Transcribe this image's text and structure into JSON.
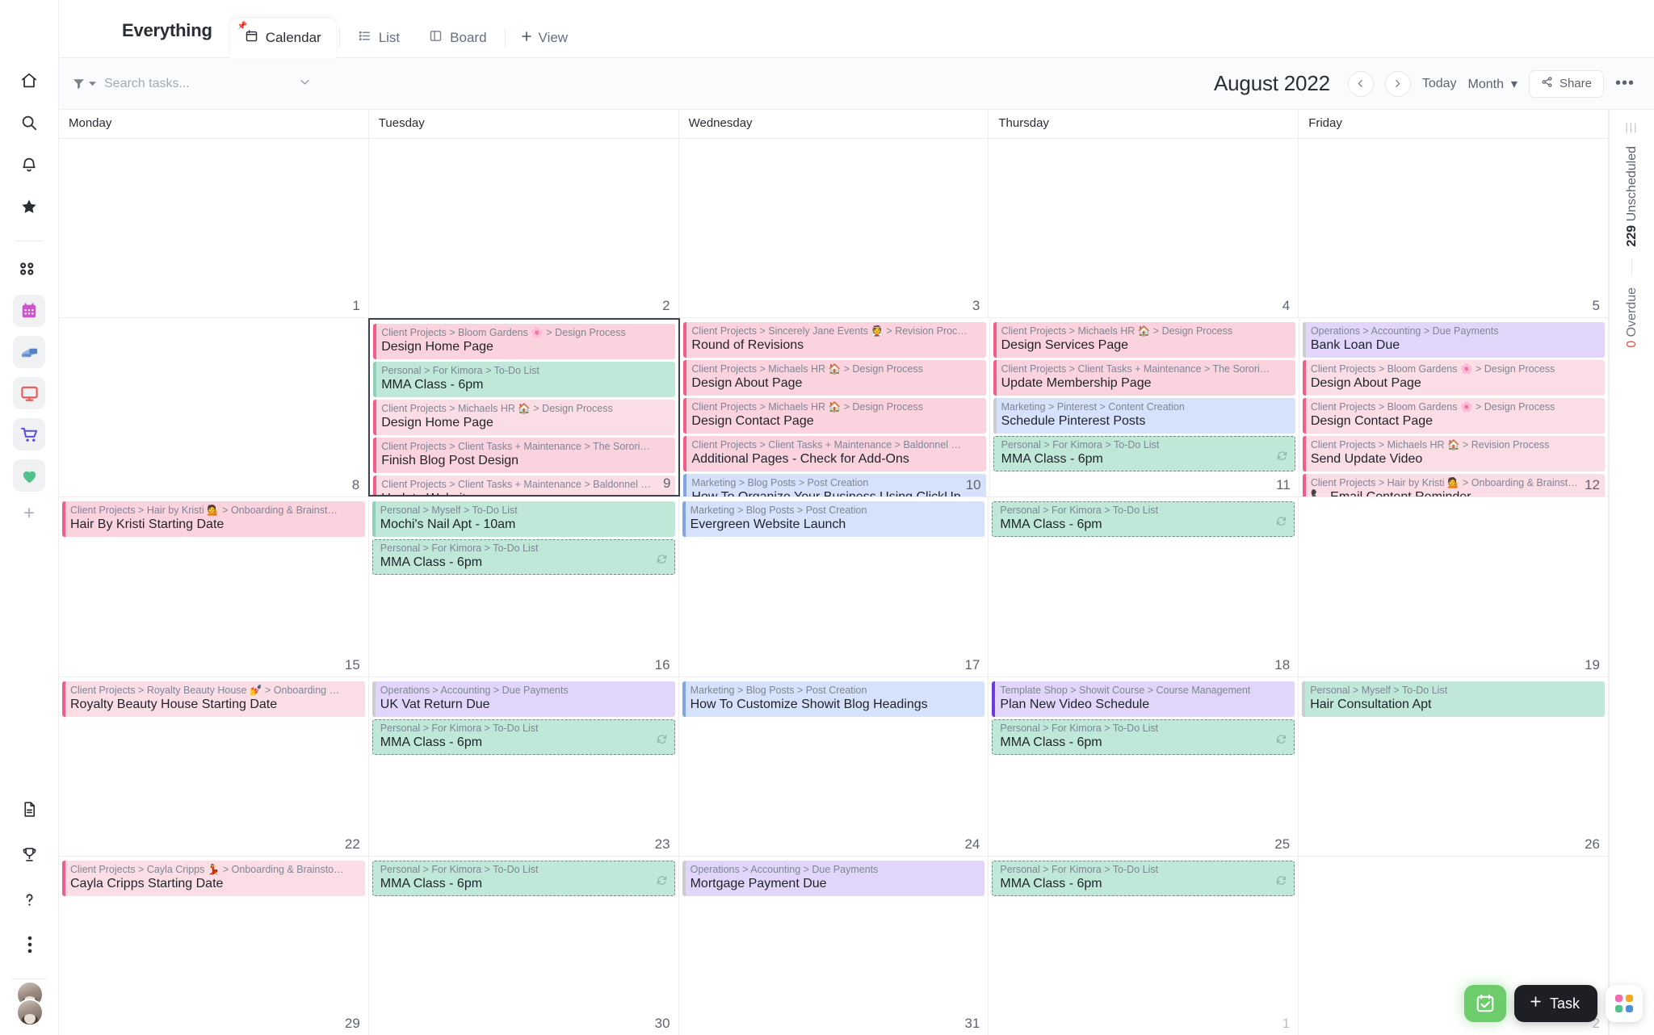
{
  "tabstrip": {
    "view_title": "Everything",
    "tabs": [
      {
        "label": "Calendar",
        "icon": "calendar-icon",
        "active": true,
        "pinned": true
      },
      {
        "label": "List",
        "icon": "list-icon",
        "active": false,
        "pinned": false
      },
      {
        "label": "Board",
        "icon": "board-icon",
        "active": false,
        "pinned": false
      }
    ],
    "add_view_label": "View"
  },
  "toolbar": {
    "search_placeholder": "Search tasks...",
    "search_value": "",
    "month_title": "August 2022",
    "today_label": "Today",
    "range_label": "Month",
    "share_label": "Share",
    "more_label": "•••"
  },
  "right_rail": {
    "unscheduled_count": "229",
    "unscheduled_label": "Unscheduled",
    "overdue_count": "0",
    "overdue_label": "Overdue"
  },
  "fab": {
    "task_label": "Task"
  },
  "sidebar": {
    "top_icons": [
      {
        "name": "home-icon"
      },
      {
        "name": "search-icon"
      },
      {
        "name": "notifications-bell-icon"
      },
      {
        "name": "favorites-star-icon"
      },
      {
        "name": "apps-grid-icon"
      }
    ],
    "spaces": [
      {
        "name": "calendar-space-icon",
        "color": "#cc55cc"
      },
      {
        "name": "payments-space-icon",
        "color": "#4f81c7"
      },
      {
        "name": "monitor-space-icon",
        "color": "#f2544d"
      },
      {
        "name": "shop-space-icon",
        "color": "#5b4de0"
      },
      {
        "name": "heart-space-icon",
        "color": "#51c38a"
      }
    ],
    "bottom_icons": [
      {
        "name": "docs-icon"
      },
      {
        "name": "trophy-icon"
      },
      {
        "name": "help-icon"
      },
      {
        "name": "more-vertical-icon"
      }
    ]
  },
  "calendar": {
    "day_names": [
      "Monday",
      "Tuesday",
      "Wednesday",
      "Thursday",
      "Friday"
    ],
    "colors": {
      "pink_bg": "#fbd3de",
      "pink_bar": "#f35d8a",
      "pink_light_bg": "#fbdde5",
      "green_bg": "#bfe8d8",
      "green_bar": "#8fd0ba",
      "blue_bg": "#d6e2fb",
      "blue_bar": "#7fa4e8",
      "purple_bg": "#e2d5fa",
      "purple_bar": "#c9b9e8",
      "purple_bar_strong": "#6c3ce0",
      "gray_bar": "#c9ccd1"
    },
    "weeks": [
      {
        "days": [
          {
            "num": "1",
            "muted": false,
            "selected": false,
            "tasks": []
          },
          {
            "num": "2",
            "muted": false,
            "selected": false,
            "tasks": []
          },
          {
            "num": "3",
            "muted": false,
            "selected": false,
            "tasks": []
          },
          {
            "num": "4",
            "muted": false,
            "selected": false,
            "tasks": []
          },
          {
            "num": "5",
            "muted": false,
            "selected": false,
            "tasks": []
          }
        ]
      },
      {
        "days": [
          {
            "num": "8",
            "muted": false,
            "selected": false,
            "tasks": []
          },
          {
            "num": "9",
            "muted": false,
            "selected": true,
            "tasks": [
              {
                "crumb": "Client Projects > Bloom Gardens 🌸 > Design Process",
                "name": "Design Home Page",
                "bg": "#fbd3de",
                "bar": "#f35d8a",
                "style": "solid",
                "recurring": false
              },
              {
                "crumb": "Personal > For Kimora > To-Do List",
                "name": "MMA Class - 6pm",
                "bg": "#bfe8d8",
                "bar": "#8fd0ba",
                "style": "solid",
                "recurring": false
              },
              {
                "crumb": "Client Projects > Michaels HR 🏠 > Design Process",
                "name": "Design Home Page",
                "bg": "#fbdde5",
                "bar": "#f35d8a",
                "style": "solid",
                "recurring": false
              },
              {
                "crumb": "Client Projects > Client Tasks + Maintenance > The Sorori…",
                "name": "Finish Blog Post Design",
                "bg": "#fbd3de",
                "bar": "#f35d8a",
                "style": "solid",
                "recurring": false
              },
              {
                "crumb": "Client Projects > Client Tasks + Maintenance > Baldonnel …",
                "name": "Update Website",
                "bg": "#fbdde5",
                "bar": "#f35d8a",
                "style": "solid",
                "recurring": false
              }
            ]
          },
          {
            "num": "10",
            "muted": false,
            "selected": false,
            "tasks": [
              {
                "crumb": "Client Projects > Sincerely Jane Events 👰 > Revision Proc…",
                "name": "Round of Revisions",
                "bg": "#fbd3de",
                "bar": "#f35d8a",
                "style": "solid",
                "recurring": false
              },
              {
                "crumb": "Client Projects > Michaels HR 🏠 > Design Process",
                "name": "Design About Page",
                "bg": "#fbd3de",
                "bar": "#f35d8a",
                "style": "solid",
                "recurring": false
              },
              {
                "crumb": "Client Projects > Michaels HR 🏠 > Design Process",
                "name": "Design Contact Page",
                "bg": "#fbd3de",
                "bar": "#f35d8a",
                "style": "solid",
                "recurring": false
              },
              {
                "crumb": "Client Projects > Client Tasks + Maintenance > Baldonnel …",
                "name": "Additional Pages - Check for Add-Ons",
                "bg": "#fbd3de",
                "bar": "#f35d8a",
                "style": "solid",
                "recurring": false
              },
              {
                "crumb": "Marketing > Blog Posts > Post Creation",
                "name": "How To Organize Your Business Using ClickUp",
                "bg": "#d6e2fb",
                "bar": "#7fa4e8",
                "style": "solid",
                "recurring": false
              }
            ]
          },
          {
            "num": "11",
            "muted": false,
            "selected": false,
            "tasks": [
              {
                "crumb": "Client Projects > Michaels HR 🏠 > Design Process",
                "name": "Design Services Page",
                "bg": "#fbd3de",
                "bar": "#f35d8a",
                "style": "solid",
                "recurring": false
              },
              {
                "crumb": "Client Projects > Client Tasks + Maintenance > The Sorori…",
                "name": "Update Membership Page",
                "bg": "#fbd3de",
                "bar": "#f35d8a",
                "style": "solid",
                "recurring": false
              },
              {
                "crumb": "Marketing > Pinterest > Content Creation",
                "name": "Schedule Pinterest Posts",
                "bg": "#d6e2fb",
                "bar": "#c9ccd1",
                "style": "solid",
                "recurring": false
              },
              {
                "crumb": "Personal > For Kimora > To-Do List",
                "name": "MMA Class - 6pm",
                "bg": "#bfe8d8",
                "bar": "#8fd0ba",
                "style": "dashed",
                "recurring": true
              }
            ]
          },
          {
            "num": "12",
            "muted": false,
            "selected": false,
            "tasks": [
              {
                "crumb": "Operations > Accounting > Due Payments",
                "name": "Bank Loan Due",
                "bg": "#e2d5fa",
                "bar": "#c9ccd1",
                "style": "solid",
                "recurring": false
              },
              {
                "crumb": "Client Projects > Bloom Gardens 🌸 > Design Process",
                "name": "Design About Page",
                "bg": "#fbdde5",
                "bar": "#f35d8a",
                "style": "solid",
                "recurring": false
              },
              {
                "crumb": "Client Projects > Bloom Gardens 🌸 > Design Process",
                "name": "Design Contact Page",
                "bg": "#fbdde5",
                "bar": "#f35d8a",
                "style": "solid",
                "recurring": false
              },
              {
                "crumb": "Client Projects > Michaels HR 🏠 > Revision Process",
                "name": "Send Update Video",
                "bg": "#fbdde5",
                "bar": "#f35d8a",
                "style": "solid",
                "recurring": false
              },
              {
                "crumb": "Client Projects > Hair by Kristi 💁 > Onboarding & Brainst…",
                "name": "📞 Email Content Reminder",
                "bg": "#fbdde5",
                "bar": "#f35d8a",
                "style": "solid",
                "recurring": false
              }
            ]
          }
        ]
      },
      {
        "days": [
          {
            "num": "15",
            "muted": false,
            "selected": false,
            "tasks": [
              {
                "crumb": "Client Projects > Hair by Kristi 💁 > Onboarding & Brainst…",
                "name": "Hair By Kristi Starting Date",
                "bg": "#fbd3de",
                "bar": "#f35d8a",
                "style": "solid",
                "recurring": false
              }
            ]
          },
          {
            "num": "16",
            "muted": false,
            "selected": false,
            "tasks": [
              {
                "crumb": "Personal > Myself > To-Do List",
                "name": "Mochi's Nail Apt - 10am",
                "bg": "#bfe8d8",
                "bar": "#8fd0ba",
                "style": "solid",
                "recurring": false
              },
              {
                "crumb": "Personal > For Kimora > To-Do List",
                "name": "MMA Class - 6pm",
                "bg": "#bfe8d8",
                "bar": "#8fd0ba",
                "style": "dashed",
                "recurring": true
              }
            ]
          },
          {
            "num": "17",
            "muted": false,
            "selected": false,
            "tasks": [
              {
                "crumb": "Marketing > Blog Posts > Post Creation",
                "name": "Evergreen Website Launch",
                "bg": "#d6e2fb",
                "bar": "#7fa4e8",
                "style": "solid",
                "recurring": false
              }
            ]
          },
          {
            "num": "18",
            "muted": false,
            "selected": false,
            "tasks": [
              {
                "crumb": "Personal > For Kimora > To-Do List",
                "name": "MMA Class - 6pm",
                "bg": "#bfe8d8",
                "bar": "#8fd0ba",
                "style": "dashed",
                "recurring": true
              }
            ]
          },
          {
            "num": "19",
            "muted": false,
            "selected": false,
            "tasks": []
          }
        ]
      },
      {
        "days": [
          {
            "num": "22",
            "muted": false,
            "selected": false,
            "tasks": [
              {
                "crumb": "Client Projects > Royalty Beauty House 💅 > Onboarding …",
                "name": "Royalty Beauty House Starting Date",
                "bg": "#fbdde5",
                "bar": "#f35d8a",
                "style": "solid",
                "recurring": false
              }
            ]
          },
          {
            "num": "23",
            "muted": false,
            "selected": false,
            "tasks": [
              {
                "crumb": "Operations > Accounting > Due Payments",
                "name": "UK Vat Return Due",
                "bg": "#e2d5fa",
                "bar": "#c9ccd1",
                "style": "solid",
                "recurring": false
              },
              {
                "crumb": "Personal > For Kimora > To-Do List",
                "name": "MMA Class - 6pm",
                "bg": "#bfe8d8",
                "bar": "#8fd0ba",
                "style": "dashed",
                "recurring": true
              }
            ]
          },
          {
            "num": "24",
            "muted": false,
            "selected": false,
            "tasks": [
              {
                "crumb": "Marketing > Blog Posts > Post Creation",
                "name": "How To Customize Showit Blog Headings",
                "bg": "#d6e2fb",
                "bar": "#7fa4e8",
                "style": "solid",
                "recurring": false
              }
            ]
          },
          {
            "num": "25",
            "muted": false,
            "selected": false,
            "tasks": [
              {
                "crumb": "Template Shop > Showit Course > Course Management",
                "name": "Plan New Video Schedule",
                "bg": "#e2d5fa",
                "bar": "#6c3ce0",
                "style": "solid",
                "recurring": false
              },
              {
                "crumb": "Personal > For Kimora > To-Do List",
                "name": "MMA Class - 6pm",
                "bg": "#bfe8d8",
                "bar": "#8fd0ba",
                "style": "dashed",
                "recurring": true
              }
            ]
          },
          {
            "num": "26",
            "muted": false,
            "selected": false,
            "tasks": [
              {
                "crumb": "Personal > Myself > To-Do List",
                "name": "Hair Consultation Apt",
                "bg": "#bfe8d8",
                "bar": "#c9ccd1",
                "style": "solid",
                "recurring": false
              }
            ]
          }
        ]
      },
      {
        "days": [
          {
            "num": "29",
            "muted": false,
            "selected": false,
            "tasks": [
              {
                "crumb": "Client Projects > Cayla Cripps 💃 > Onboarding & Brainsto…",
                "name": "Cayla Cripps Starting Date",
                "bg": "#fbdde5",
                "bar": "#f35d8a",
                "style": "solid",
                "recurring": false
              }
            ]
          },
          {
            "num": "30",
            "muted": false,
            "selected": false,
            "tasks": [
              {
                "crumb": "Personal > For Kimora > To-Do List",
                "name": "MMA Class - 6pm",
                "bg": "#bfe8d8",
                "bar": "#8fd0ba",
                "style": "dashed",
                "recurring": true
              }
            ]
          },
          {
            "num": "31",
            "muted": false,
            "selected": false,
            "tasks": [
              {
                "crumb": "Operations > Accounting > Due Payments",
                "name": "Mortgage Payment Due",
                "bg": "#e2d5fa",
                "bar": "#c9ccd1",
                "style": "solid",
                "recurring": false
              }
            ]
          },
          {
            "num": "1",
            "muted": true,
            "selected": false,
            "tasks": [
              {
                "crumb": "Personal > For Kimora > To-Do List",
                "name": "MMA Class - 6pm",
                "bg": "#bfe8d8",
                "bar": "#8fd0ba",
                "style": "dashed",
                "recurring": true
              }
            ]
          },
          {
            "num": "2",
            "muted": true,
            "selected": false,
            "tasks": []
          }
        ]
      }
    ]
  }
}
